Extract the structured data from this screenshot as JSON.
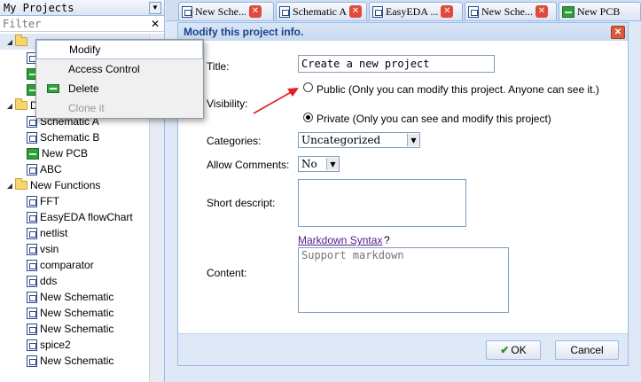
{
  "left_panel": {
    "title": "My Projects",
    "filter_placeholder": "Filter",
    "tree": [
      {
        "label": "",
        "kind": "folder"
      },
      {
        "label": "",
        "kind": "schematic"
      },
      {
        "label": "",
        "kind": "pcb"
      },
      {
        "label": "",
        "kind": "pcb"
      },
      {
        "label": "D",
        "kind": "folder"
      },
      {
        "label": "Schematic A",
        "kind": "schematic"
      },
      {
        "label": "Schematic B",
        "kind": "schematic"
      },
      {
        "label": "New PCB",
        "kind": "pcb"
      },
      {
        "label": "ABC",
        "kind": "schematic"
      },
      {
        "label": "New Functions",
        "kind": "folder"
      },
      {
        "label": "FFT",
        "kind": "schematic"
      },
      {
        "label": "EasyEDA flowChart",
        "kind": "schematic"
      },
      {
        "label": "netlist",
        "kind": "schematic"
      },
      {
        "label": "vsin",
        "kind": "schematic"
      },
      {
        "label": "comparator",
        "kind": "schematic"
      },
      {
        "label": "dds",
        "kind": "schematic"
      },
      {
        "label": "New Schematic",
        "kind": "schematic"
      },
      {
        "label": "New Schematic",
        "kind": "schematic"
      },
      {
        "label": "New Schematic",
        "kind": "schematic"
      },
      {
        "label": "spice2",
        "kind": "schematic"
      },
      {
        "label": "New Schematic",
        "kind": "schematic"
      }
    ]
  },
  "tabs": [
    {
      "label": "New Sche..."
    },
    {
      "label": "Schematic A"
    },
    {
      "label": "EasyEDA ..."
    },
    {
      "label": "New Sche..."
    },
    {
      "label": "New PCB"
    }
  ],
  "context_menu": {
    "modify": "Modify",
    "access_control": "Access Control",
    "delete": "Delete",
    "clone": "Clone it"
  },
  "dialog": {
    "title": "Modify this project info.",
    "title_label": "Title:",
    "title_value": "Create a new project",
    "visibility_label": "Visibility:",
    "public_label": "Public (Only you can modify this project. Anyone can see it.)",
    "private_label": "Private (Only you can see and modify this project)",
    "visibility_selected": "private",
    "categories_label": "Categories:",
    "categories_value": "Uncategorized",
    "allow_comments_label": "Allow Comments:",
    "allow_comments_value": "No",
    "short_desc_label": "Short descript:",
    "markdown_link": "Markdown Syntax",
    "markdown_q": "?",
    "content_label": "Content:",
    "content_placeholder": "Support markdown",
    "ok_label": "OK",
    "cancel_label": "Cancel"
  },
  "colors": {
    "accent": "#15428b",
    "arrow": "#e01f1f",
    "link": "#551a8b"
  }
}
